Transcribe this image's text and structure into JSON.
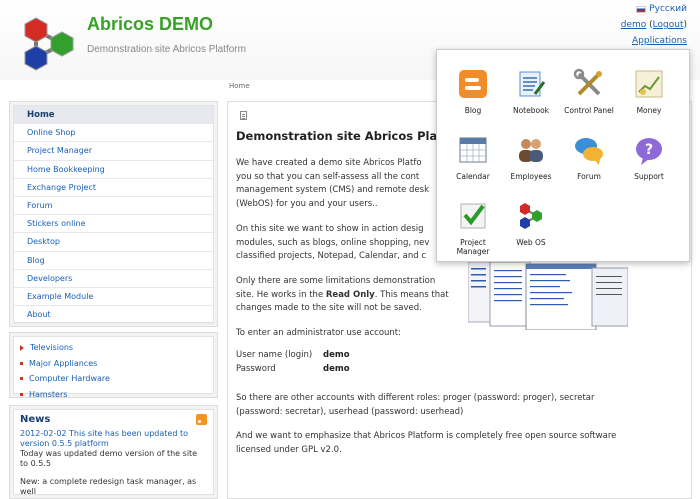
{
  "header": {
    "title": "Abricos DEMO",
    "subtitle": "Demonstration site Abricos Platform",
    "language": "Русский",
    "user": "demo",
    "logout": "Logout",
    "applications": "Applications"
  },
  "breadcrumb": "Home",
  "menu": [
    {
      "label": "Home",
      "active": true
    },
    {
      "label": "Online Shop"
    },
    {
      "label": "Project Manager"
    },
    {
      "label": "Home Bookkeeping"
    },
    {
      "label": "Exchange Project"
    },
    {
      "label": "Forum"
    },
    {
      "label": "Stickers online"
    },
    {
      "label": "Desktop"
    },
    {
      "label": "Blog"
    },
    {
      "label": "Developers"
    },
    {
      "label": "Example Module"
    },
    {
      "label": "About"
    }
  ],
  "categories": [
    "Televisions",
    "Major Appliances",
    "Computer Hardware",
    "Hamsters"
  ],
  "news": {
    "heading": "News",
    "title": "2012-02-02 This site has been updated to version 0.5.5 platform",
    "text": "Today was updated demo version of the site to 0.5.5",
    "text2": "New: a complete redesign task manager, as well"
  },
  "content": {
    "title": "Demonstration site Abricos Platf",
    "p1": "We have created a demo site Abricos Platfo\nyou so that you can self-assess all the cont\nmanagement system (CMS) and remote desk\n(WebOS) for you and your users..",
    "p2": "On this site we want to show in action desig\nmodules, such as blogs, online shopping, nev\nclassified projects, Notepad, Calendar, and c",
    "p3a": "Only there are some limitations demonstration",
    "p3b": "site. He works in the ",
    "p3b_bold": "Read Only",
    "p3b_tail": ". This means that",
    "p3c": "changes made to the site will not be saved.",
    "p4": "To enter an administrator use account:",
    "login_label": "User name (login)",
    "login_value": "demo",
    "password_label": "Password",
    "password_value": "demo",
    "p5": "So there are other accounts with different roles: proger (password: proger), secretar\n(password: secretar), userhead (password: userhead)",
    "p6": "And we want to emphasize that Abricos Platform is completely free open source software\nlicensed under GPL v2.0."
  },
  "apps": [
    {
      "label": "Blog",
      "icon": "blog-icon"
    },
    {
      "label": "Notebook",
      "icon": "notebook-icon"
    },
    {
      "label": "Control Panel",
      "icon": "control-panel-icon"
    },
    {
      "label": "Money",
      "icon": "money-icon"
    },
    {
      "label": "Calendar",
      "icon": "calendar-icon"
    },
    {
      "label": "Employees",
      "icon": "employees-icon"
    },
    {
      "label": "Forum",
      "icon": "forum-icon"
    },
    {
      "label": "Support",
      "icon": "support-icon"
    },
    {
      "label": "Project Manager",
      "icon": "project-manager-icon"
    },
    {
      "label": "Web OS",
      "icon": "webos-icon"
    }
  ],
  "colors": {
    "title_green": "#3aa028",
    "link_blue": "#1a5fb4",
    "menu_active_bg": "#e6e9ee"
  }
}
